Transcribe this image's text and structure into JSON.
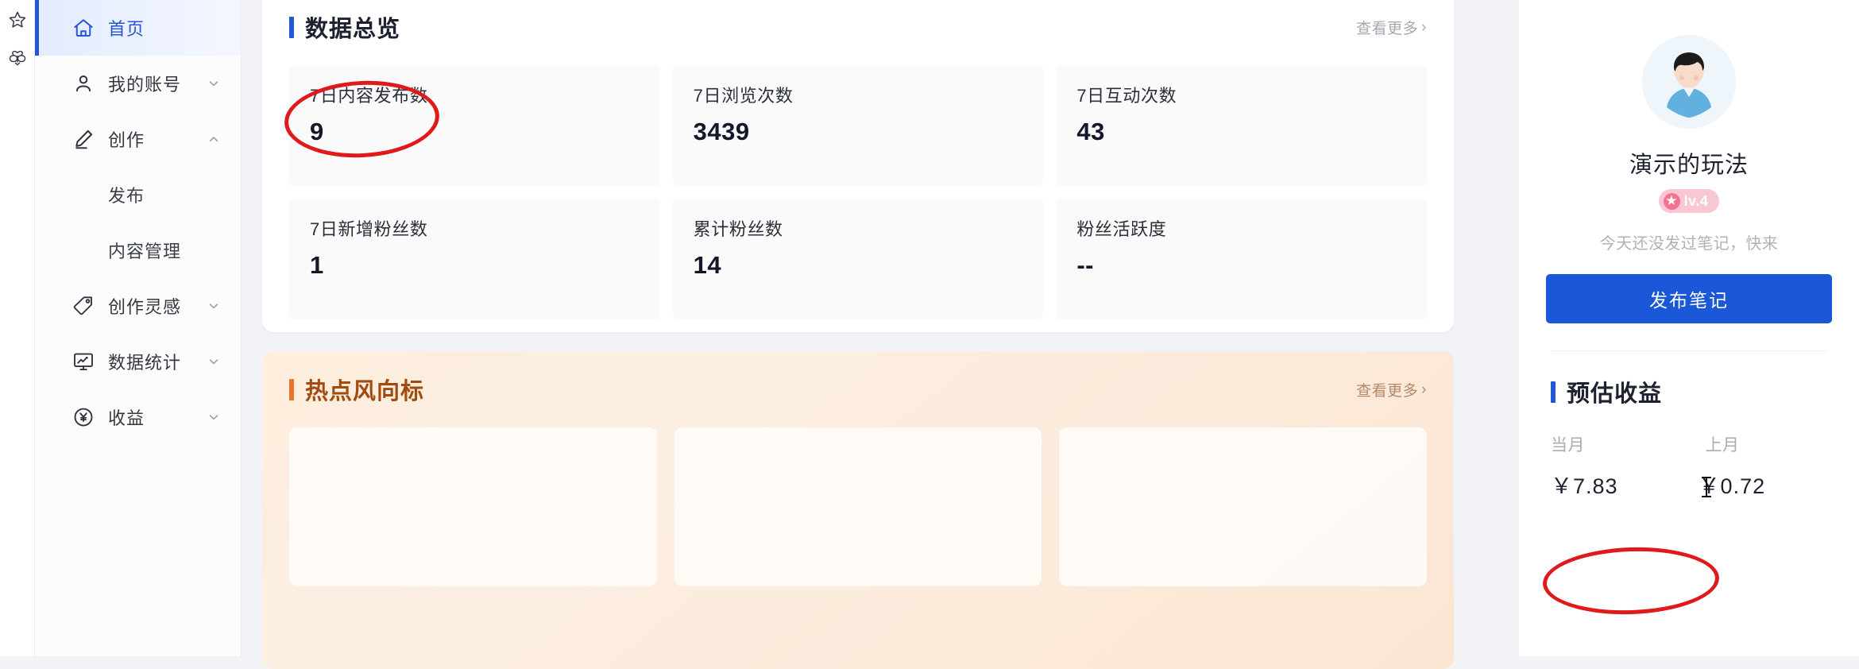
{
  "rail": {
    "icons": [
      {
        "name": "star-outline-icon"
      },
      {
        "name": "bee-icon"
      }
    ]
  },
  "sidebar": {
    "items": [
      {
        "label": "首页",
        "icon": "home-icon",
        "active": true,
        "expandable": false
      },
      {
        "label": "我的账号",
        "icon": "user-icon",
        "active": false,
        "expandable": true,
        "chevron": "down"
      },
      {
        "label": "创作",
        "icon": "pencil-icon",
        "active": false,
        "expandable": true,
        "chevron": "up"
      },
      {
        "label": "发布",
        "icon": "",
        "sub": true
      },
      {
        "label": "内容管理",
        "icon": "",
        "sub": true
      },
      {
        "label": "创作灵感",
        "icon": "tag-icon",
        "active": false,
        "expandable": true,
        "chevron": "down"
      },
      {
        "label": "数据统计",
        "icon": "monitor-chart-icon",
        "active": false,
        "expandable": true,
        "chevron": "down"
      },
      {
        "label": "收益",
        "icon": "yen-coin-icon",
        "active": false,
        "expandable": true,
        "chevron": "down"
      }
    ]
  },
  "overview": {
    "title": "数据总览",
    "more_label": "查看更多",
    "more_chevron": "›",
    "stats": [
      {
        "label": "7日内容发布数",
        "value": "9"
      },
      {
        "label": "7日浏览次数",
        "value": "3439"
      },
      {
        "label": "7日互动次数",
        "value": "43"
      },
      {
        "label": "7日新增粉丝数",
        "value": "1"
      },
      {
        "label": "累计粉丝数",
        "value": "14"
      },
      {
        "label": "粉丝活跃度",
        "value": "--"
      }
    ]
  },
  "hotspot": {
    "title": "热点风向标",
    "more_label": "查看更多",
    "more_chevron": "›"
  },
  "profile": {
    "avatar_icon": "user-avatar",
    "username": "演示的玩法",
    "level_badge": "lv.4",
    "level_star_icon": "star-icon",
    "tip": "今天还没发过笔记，快来",
    "publish_button": "发布笔记"
  },
  "earnings": {
    "title": "预估收益",
    "items": [
      {
        "label": "当月",
        "value": "￥7.83"
      },
      {
        "label": "上月",
        "value": "￥0.72"
      }
    ]
  },
  "colors": {
    "accent_blue": "#2456d6",
    "button_blue": "#1a58d8",
    "hot_orange": "#a24b10",
    "hot_bar": "#e8762a",
    "badge_pink": "#f9c6d4",
    "annotation_red": "#e0191b"
  }
}
